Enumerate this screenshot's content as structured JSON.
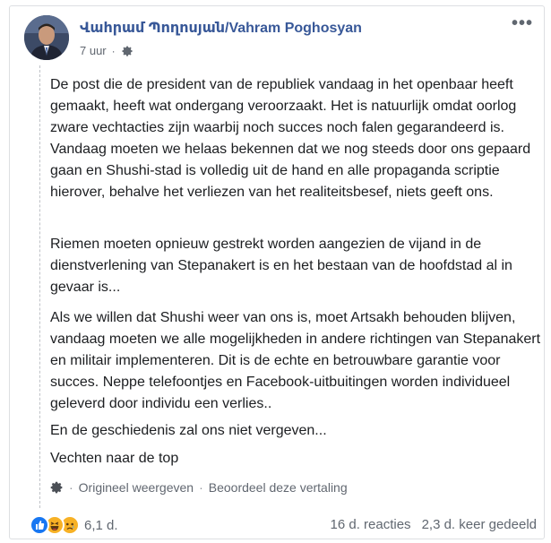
{
  "post": {
    "author": "Վահրամ Պողոսյան/Vahram Poghosyan",
    "time": "7 uur",
    "time_separator": "·",
    "more_label": "•••",
    "paragraphs": [
      "De post die de president van de republiek vandaag in het openbaar heeft gemaakt, heeft wat ondergang veroorzaakt. Het is natuurlijk omdat oorlog zware vechtacties zijn waarbij noch succes noch falen gegarandeerd is. Vandaag moeten we helaas bekennen dat we nog steeds door ons gepaard gaan en Shushi-stad is volledig uit de hand en alle propaganda scriptie hierover, behalve het verliezen van het realiteitsbesef, niets geeft ons.",
      "Riemen moeten opnieuw gestrekt worden aangezien de vijand in de dienstverlening van Stepanakert is en het bestaan van de hoofdstad al in gevaar is...",
      "Als we willen dat Shushi weer van ons is, moet Artsakh behouden blijven, vandaag moeten we alle mogelijkheden in andere richtingen van Stepanakert en militair implementeren. Dit is de echte en betrouwbare garantie voor succes. Neppe telefoontjes en Facebook-uitbuitingen worden individueel geleverd door individu een verlies..",
      "En de geschiedenis zal ons niet vergeven...",
      "Vechten naar de top"
    ],
    "see_original": "Origineel weergeven",
    "separator": "·",
    "rate_translation": "Beoordeel deze vertaling"
  },
  "footer": {
    "reaction_icons": [
      "like-reaction-icon",
      "haha-reaction-icon",
      "sad-reaction-icon"
    ],
    "reaction_count": "6,1 d.",
    "comments": "16 d. reacties",
    "shares": "2,3 d. keer gedeeld"
  },
  "colors": {
    "author_link": "#385898",
    "like_blue": "#1877f2",
    "emoji_yellow": "#f7b125",
    "meta_gray": "#616770"
  }
}
